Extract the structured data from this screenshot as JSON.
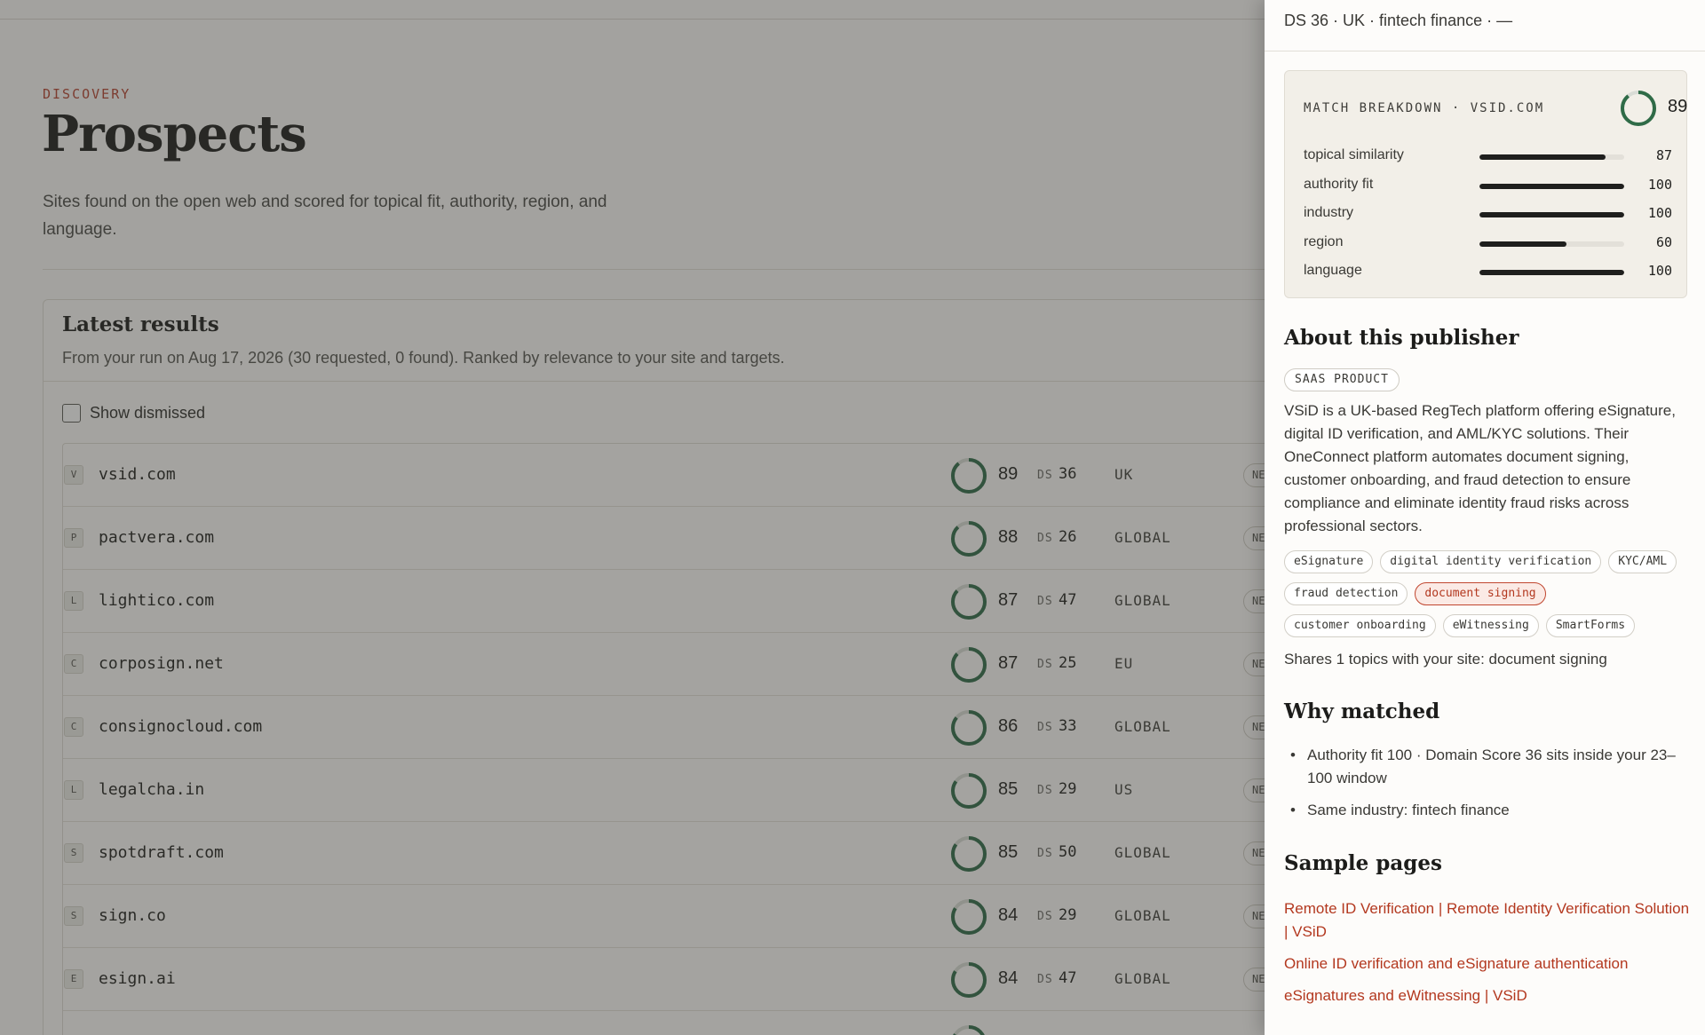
{
  "page": {
    "eyebrow": "DISCOVERY",
    "title": "Prospects",
    "description": "Sites found on the open web and scored for topical fit, authority, region, and language."
  },
  "results": {
    "title": "Latest results",
    "subtitle": "From your run on Aug 17, 2026 (30 requested, 0 found). Ranked by relevance to your site and targets.",
    "show_dismissed_label": "Show dismissed",
    "ds_label": "DS",
    "tag_label": "NEW",
    "rows": [
      {
        "letter": "V",
        "domain": "vsid.com",
        "score": "89",
        "ds": "36",
        "region": "UK"
      },
      {
        "letter": "P",
        "domain": "pactvera.com",
        "score": "88",
        "ds": "26",
        "region": "GLOBAL"
      },
      {
        "letter": "L",
        "domain": "lightico.com",
        "score": "87",
        "ds": "47",
        "region": "GLOBAL"
      },
      {
        "letter": "C",
        "domain": "corposign.net",
        "score": "87",
        "ds": "25",
        "region": "EU"
      },
      {
        "letter": "C",
        "domain": "consignocloud.com",
        "score": "86",
        "ds": "33",
        "region": "GLOBAL"
      },
      {
        "letter": "L",
        "domain": "legalcha.in",
        "score": "85",
        "ds": "29",
        "region": "US"
      },
      {
        "letter": "S",
        "domain": "spotdraft.com",
        "score": "85",
        "ds": "50",
        "region": "GLOBAL"
      },
      {
        "letter": "S",
        "domain": "sign.co",
        "score": "84",
        "ds": "29",
        "region": "GLOBAL"
      },
      {
        "letter": "E",
        "domain": "esign.ai",
        "score": "84",
        "ds": "47",
        "region": "GLOBAL"
      },
      {
        "letter": "",
        "domain": "",
        "score": "",
        "ds": "",
        "region": ""
      }
    ]
  },
  "drawer": {
    "header": "DS 36 · UK · fintech finance · —",
    "breakdown": {
      "title": "MATCH BREAKDOWN · VSID.COM",
      "score": "89",
      "metrics": [
        {
          "label": "topical similarity",
          "value": "87"
        },
        {
          "label": "authority fit",
          "value": "100"
        },
        {
          "label": "industry",
          "value": "100"
        },
        {
          "label": "region",
          "value": "60"
        },
        {
          "label": "language",
          "value": "100"
        }
      ]
    },
    "about": {
      "title": "About this publisher",
      "category": "SAAS PRODUCT",
      "text": "VSiD is a UK-based RegTech platform offering eSignature, digital ID verification, and AML/KYC solutions. Their OneConnect platform automates document signing, customer onboarding, and fraud detection to ensure compliance and eliminate identity fraud risks across professional sectors.",
      "topics": [
        {
          "label": "eSignature",
          "shared": false
        },
        {
          "label": "digital identity verification",
          "shared": false
        },
        {
          "label": "KYC/AML",
          "shared": false
        },
        {
          "label": "fraud detection",
          "shared": false
        },
        {
          "label": "document signing",
          "shared": true
        },
        {
          "label": "customer onboarding",
          "shared": false
        },
        {
          "label": "eWitnessing",
          "shared": false
        },
        {
          "label": "SmartForms",
          "shared": false
        }
      ],
      "shares": "Shares 1 topics with your site: document signing"
    },
    "why": {
      "title": "Why matched",
      "items": [
        "Authority fit 100 · Domain Score 36 sits inside your 23–100 window",
        "Same industry: fintech finance"
      ]
    },
    "samples": {
      "title": "Sample pages",
      "links": [
        "Remote ID Verification | Remote Identity Verification Solution | VSiD",
        "Online ID verification and eSignature authentication",
        "eSignatures and eWitnessing | VSiD"
      ]
    }
  },
  "colors": {
    "accent": "#b5412e",
    "ring": "#2f6b47",
    "ring_track": "#d9dcd6"
  }
}
